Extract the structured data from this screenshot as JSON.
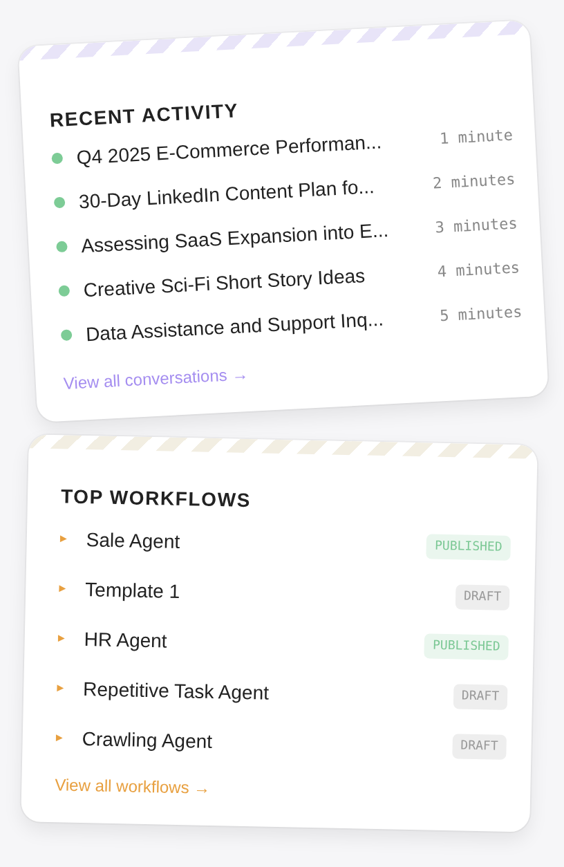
{
  "recent_activity": {
    "title": "RECENT ACTIVITY",
    "items": [
      {
        "title": "Q4 2025 E-Commerce Performan...",
        "time": "1 minute"
      },
      {
        "title": "30-Day LinkedIn Content Plan fo...",
        "time": "2 minutes"
      },
      {
        "title": "Assessing SaaS Expansion into E...",
        "time": "3 minutes"
      },
      {
        "title": "Creative Sci-Fi Short Story Ideas",
        "time": "4 minutes"
      },
      {
        "title": "Data Assistance and Support Inq...",
        "time": "5 minutes"
      }
    ],
    "link": "View all conversations →"
  },
  "top_workflows": {
    "title": "TOP WORKFLOWS",
    "items": [
      {
        "name": "Sale Agent",
        "status": "PUBLISHED",
        "kind": "published"
      },
      {
        "name": "Template 1",
        "status": "DRAFT",
        "kind": "draft"
      },
      {
        "name": "HR Agent",
        "status": "PUBLISHED",
        "kind": "published"
      },
      {
        "name": "Repetitive Task Agent",
        "status": "DRAFT",
        "kind": "draft"
      },
      {
        "name": "Crawling Agent",
        "status": "DRAFT",
        "kind": "draft"
      }
    ],
    "link": "View all workflows →"
  }
}
